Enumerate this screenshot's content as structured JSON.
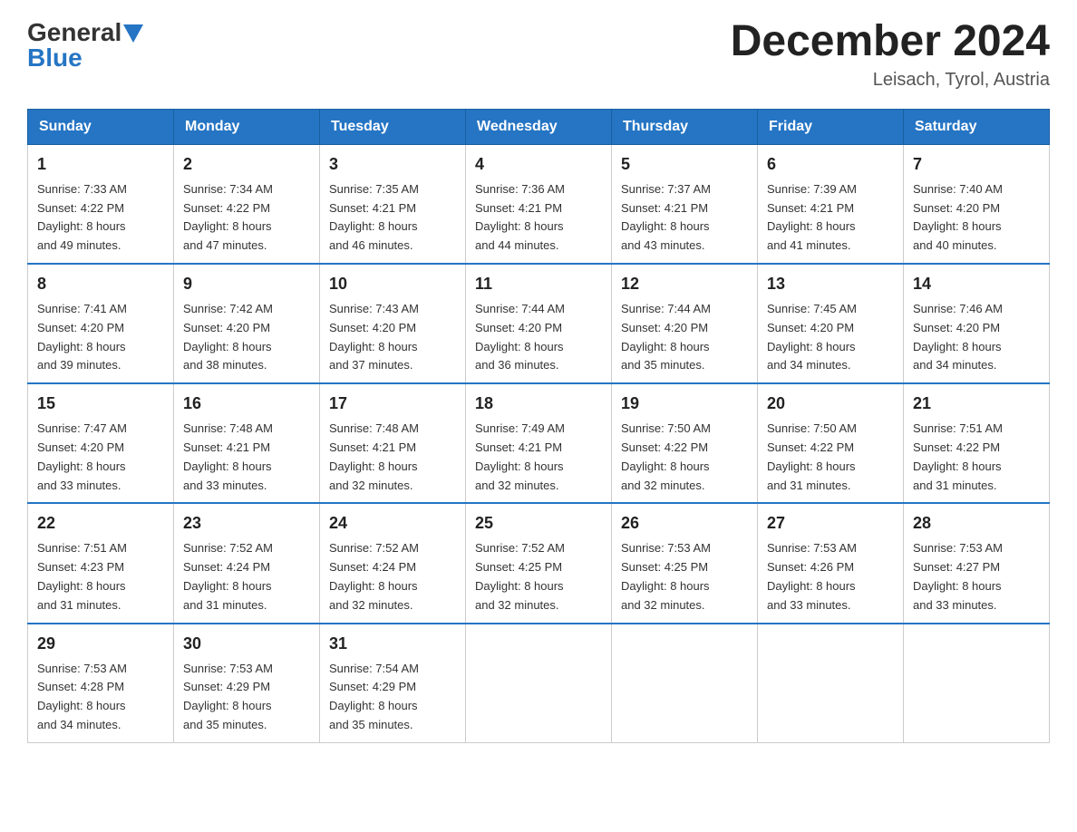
{
  "logo": {
    "general": "General",
    "blue": "Blue"
  },
  "header": {
    "month_year": "December 2024",
    "location": "Leisach, Tyrol, Austria"
  },
  "days_of_week": [
    "Sunday",
    "Monday",
    "Tuesday",
    "Wednesday",
    "Thursday",
    "Friday",
    "Saturday"
  ],
  "weeks": [
    [
      {
        "day": "1",
        "sunrise": "7:33 AM",
        "sunset": "4:22 PM",
        "daylight_hours": "8",
        "daylight_minutes": "49"
      },
      {
        "day": "2",
        "sunrise": "7:34 AM",
        "sunset": "4:22 PM",
        "daylight_hours": "8",
        "daylight_minutes": "47"
      },
      {
        "day": "3",
        "sunrise": "7:35 AM",
        "sunset": "4:21 PM",
        "daylight_hours": "8",
        "daylight_minutes": "46"
      },
      {
        "day": "4",
        "sunrise": "7:36 AM",
        "sunset": "4:21 PM",
        "daylight_hours": "8",
        "daylight_minutes": "44"
      },
      {
        "day": "5",
        "sunrise": "7:37 AM",
        "sunset": "4:21 PM",
        "daylight_hours": "8",
        "daylight_minutes": "43"
      },
      {
        "day": "6",
        "sunrise": "7:39 AM",
        "sunset": "4:21 PM",
        "daylight_hours": "8",
        "daylight_minutes": "41"
      },
      {
        "day": "7",
        "sunrise": "7:40 AM",
        "sunset": "4:20 PM",
        "daylight_hours": "8",
        "daylight_minutes": "40"
      }
    ],
    [
      {
        "day": "8",
        "sunrise": "7:41 AM",
        "sunset": "4:20 PM",
        "daylight_hours": "8",
        "daylight_minutes": "39"
      },
      {
        "day": "9",
        "sunrise": "7:42 AM",
        "sunset": "4:20 PM",
        "daylight_hours": "8",
        "daylight_minutes": "38"
      },
      {
        "day": "10",
        "sunrise": "7:43 AM",
        "sunset": "4:20 PM",
        "daylight_hours": "8",
        "daylight_minutes": "37"
      },
      {
        "day": "11",
        "sunrise": "7:44 AM",
        "sunset": "4:20 PM",
        "daylight_hours": "8",
        "daylight_minutes": "36"
      },
      {
        "day": "12",
        "sunrise": "7:44 AM",
        "sunset": "4:20 PM",
        "daylight_hours": "8",
        "daylight_minutes": "35"
      },
      {
        "day": "13",
        "sunrise": "7:45 AM",
        "sunset": "4:20 PM",
        "daylight_hours": "8",
        "daylight_minutes": "34"
      },
      {
        "day": "14",
        "sunrise": "7:46 AM",
        "sunset": "4:20 PM",
        "daylight_hours": "8",
        "daylight_minutes": "34"
      }
    ],
    [
      {
        "day": "15",
        "sunrise": "7:47 AM",
        "sunset": "4:20 PM",
        "daylight_hours": "8",
        "daylight_minutes": "33"
      },
      {
        "day": "16",
        "sunrise": "7:48 AM",
        "sunset": "4:21 PM",
        "daylight_hours": "8",
        "daylight_minutes": "33"
      },
      {
        "day": "17",
        "sunrise": "7:48 AM",
        "sunset": "4:21 PM",
        "daylight_hours": "8",
        "daylight_minutes": "32"
      },
      {
        "day": "18",
        "sunrise": "7:49 AM",
        "sunset": "4:21 PM",
        "daylight_hours": "8",
        "daylight_minutes": "32"
      },
      {
        "day": "19",
        "sunrise": "7:50 AM",
        "sunset": "4:22 PM",
        "daylight_hours": "8",
        "daylight_minutes": "32"
      },
      {
        "day": "20",
        "sunrise": "7:50 AM",
        "sunset": "4:22 PM",
        "daylight_hours": "8",
        "daylight_minutes": "31"
      },
      {
        "day": "21",
        "sunrise": "7:51 AM",
        "sunset": "4:22 PM",
        "daylight_hours": "8",
        "daylight_minutes": "31"
      }
    ],
    [
      {
        "day": "22",
        "sunrise": "7:51 AM",
        "sunset": "4:23 PM",
        "daylight_hours": "8",
        "daylight_minutes": "31"
      },
      {
        "day": "23",
        "sunrise": "7:52 AM",
        "sunset": "4:24 PM",
        "daylight_hours": "8",
        "daylight_minutes": "31"
      },
      {
        "day": "24",
        "sunrise": "7:52 AM",
        "sunset": "4:24 PM",
        "daylight_hours": "8",
        "daylight_minutes": "32"
      },
      {
        "day": "25",
        "sunrise": "7:52 AM",
        "sunset": "4:25 PM",
        "daylight_hours": "8",
        "daylight_minutes": "32"
      },
      {
        "day": "26",
        "sunrise": "7:53 AM",
        "sunset": "4:25 PM",
        "daylight_hours": "8",
        "daylight_minutes": "32"
      },
      {
        "day": "27",
        "sunrise": "7:53 AM",
        "sunset": "4:26 PM",
        "daylight_hours": "8",
        "daylight_minutes": "33"
      },
      {
        "day": "28",
        "sunrise": "7:53 AM",
        "sunset": "4:27 PM",
        "daylight_hours": "8",
        "daylight_minutes": "33"
      }
    ],
    [
      {
        "day": "29",
        "sunrise": "7:53 AM",
        "sunset": "4:28 PM",
        "daylight_hours": "8",
        "daylight_minutes": "34"
      },
      {
        "day": "30",
        "sunrise": "7:53 AM",
        "sunset": "4:29 PM",
        "daylight_hours": "8",
        "daylight_minutes": "35"
      },
      {
        "day": "31",
        "sunrise": "7:54 AM",
        "sunset": "4:29 PM",
        "daylight_hours": "8",
        "daylight_minutes": "35"
      },
      null,
      null,
      null,
      null
    ]
  ],
  "labels": {
    "sunrise": "Sunrise:",
    "sunset": "Sunset:",
    "daylight": "Daylight:",
    "hours_suffix": "hours",
    "and": "and",
    "minutes_suffix": "minutes."
  }
}
